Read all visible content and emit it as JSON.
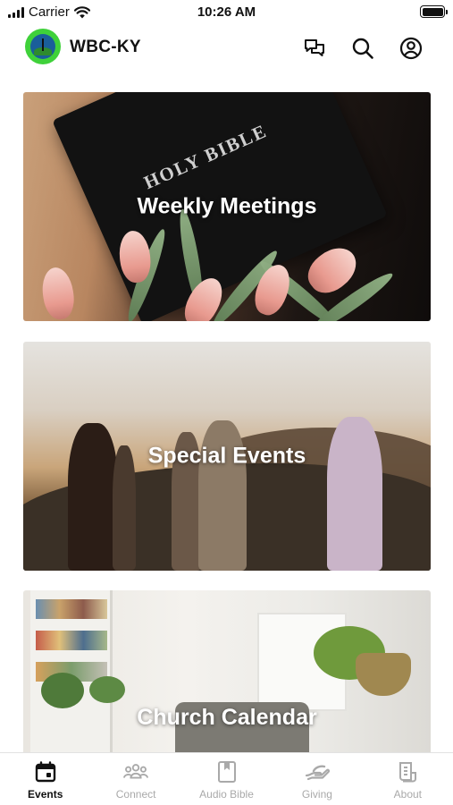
{
  "status_bar": {
    "carrier": "Carrier",
    "time": "10:26 AM",
    "icons": [
      "signal-icon",
      "wifi-icon",
      "battery-icon"
    ]
  },
  "header": {
    "title": "WBC-KY",
    "logo_colors": {
      "ring": "#3fd13a",
      "globe": "#1a5e9a"
    },
    "actions": [
      "chat-icon",
      "search-icon",
      "account-icon"
    ]
  },
  "cards": [
    {
      "label": "Weekly Meetings",
      "image": "holy-bible-with-pink-tulips",
      "image_text": "HOLY BIBLE"
    },
    {
      "label": "Special Events",
      "image": "people-at-sunset-on-hillside"
    },
    {
      "label": "Church Calendar",
      "image": "bright-living-room-with-plants"
    }
  ],
  "tab_bar": {
    "active_index": 0,
    "active_color": "#111111",
    "inactive_color": "#a9a9a9",
    "tabs": [
      {
        "label": "Events",
        "icon": "calendar-icon"
      },
      {
        "label": "Connect",
        "icon": "people-group-icon"
      },
      {
        "label": "Audio Bible",
        "icon": "bookmark-book-icon"
      },
      {
        "label": "Giving",
        "icon": "giving-hand-icon"
      },
      {
        "label": "About",
        "icon": "info-document-icon"
      }
    ]
  }
}
